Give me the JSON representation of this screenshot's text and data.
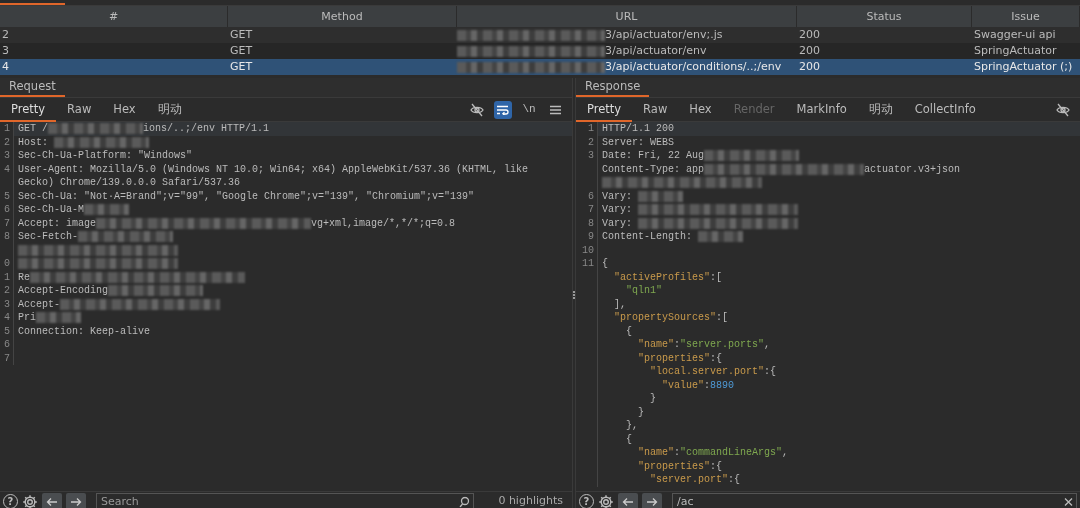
{
  "table": {
    "columns": [
      "#",
      "Method",
      "URL",
      "Status",
      "Issue"
    ],
    "rows": [
      {
        "number": "2",
        "method": "GET",
        "url_prefix_redacted": true,
        "url": "3/api/actuator/env;.js",
        "status": "200",
        "issue": "Swagger-ui api",
        "selected": false
      },
      {
        "number": "3",
        "method": "GET",
        "url_prefix_redacted": true,
        "url": "3/api/actuator/env",
        "status": "200",
        "issue": "SpringActuator",
        "selected": false
      },
      {
        "number": "4",
        "method": "GET",
        "url_prefix_redacted": true,
        "url": "3/api/actuator/conditions/..;/env",
        "status": "200",
        "issue": "SpringActuator (;)",
        "selected": true
      }
    ]
  },
  "request": {
    "title": "Request",
    "tabs": [
      {
        "label": "Pretty",
        "selected": true,
        "disabled": false
      },
      {
        "label": "Raw",
        "selected": false,
        "disabled": false
      },
      {
        "label": "Hex",
        "selected": false,
        "disabled": false
      },
      {
        "label": "明动",
        "selected": false,
        "disabled": false
      }
    ],
    "tools": [
      {
        "kind": "hide",
        "on": false
      },
      {
        "kind": "wrap",
        "on": true
      },
      {
        "kind": "newline",
        "label": "\\n",
        "on": false
      },
      {
        "kind": "menu",
        "on": false
      }
    ],
    "lines": [
      {
        "gutter": "1",
        "highlighted": true,
        "segments": [
          {
            "kind": "plain",
            "text": "GET /"
          },
          {
            "kind": "redacted_medium"
          },
          {
            "kind": "plain",
            "text": "ions/..;/env HTTP/1.1"
          }
        ]
      },
      {
        "gutter": "2",
        "highlighted": false,
        "segments": [
          {
            "kind": "plain",
            "text": "Host: "
          },
          {
            "kind": "redacted_medium"
          }
        ]
      },
      {
        "gutter": "3",
        "highlighted": false,
        "segments": [
          {
            "kind": "plain",
            "text": "Sec-Ch-Ua-Platform: \"Windows\""
          }
        ]
      },
      {
        "gutter": "4",
        "highlighted": false,
        "segments": [
          {
            "kind": "plain",
            "text": "User-Agent: Mozilla/5.0 (Windows NT 10.0; Win64; x64) AppleWebKit/537.36 (KHTML, like"
          }
        ]
      },
      {
        "highlighted": false,
        "segments": [
          {
            "kind": "plain",
            "text": "Gecko) Chrome/139.0.0.0 Safari/537.36"
          }
        ]
      },
      {
        "gutter": "5",
        "highlighted": false,
        "segments": [
          {
            "kind": "plain",
            "text": "Sec-Ch-Ua: \"Not·A=Brand\";v=\"99\", \"Google Chrome\";v=\"139\", \"Chromium\";v=\"139\""
          }
        ]
      },
      {
        "gutter": "6",
        "highlighted": false,
        "segments": [
          {
            "kind": "plain",
            "text": "Sec-Ch-Ua-M"
          },
          {
            "kind": "redacted_short"
          }
        ]
      },
      {
        "gutter": "7",
        "highlighted": false,
        "segments": [
          {
            "kind": "plain",
            "text": "Accept: image"
          },
          {
            "kind": "redacted_wide"
          },
          {
            "kind": "plain",
            "text": "vg+xml,image/*,*/*;q=0.8"
          }
        ]
      },
      {
        "gutter": "8",
        "highlighted": false,
        "segments": [
          {
            "kind": "plain",
            "text": "Sec-Fetch-"
          },
          {
            "kind": "redacted_medium"
          }
        ]
      },
      {
        "highlighted": false,
        "segments": [
          {
            "kind": "redacted_long"
          }
        ]
      },
      {
        "gutter": "0",
        "highlighted": false,
        "segments": [
          {
            "kind": "redacted_long"
          }
        ]
      },
      {
        "gutter": "1",
        "highlighted": false,
        "segments": [
          {
            "kind": "plain",
            "text": "Re"
          },
          {
            "kind": "redacted_wide"
          }
        ]
      },
      {
        "gutter": "2",
        "highlighted": false,
        "segments": [
          {
            "kind": "plain",
            "text": "Accept-Encoding"
          },
          {
            "kind": "redacted_medium"
          }
        ]
      },
      {
        "gutter": "3",
        "highlighted": false,
        "segments": [
          {
            "kind": "plain",
            "text": "Accept-"
          },
          {
            "kind": "redacted_long"
          }
        ]
      },
      {
        "gutter": "4",
        "highlighted": false,
        "segments": [
          {
            "kind": "plain",
            "text": "Pri"
          },
          {
            "kind": "redacted_short"
          }
        ]
      },
      {
        "gutter": "5",
        "highlighted": false,
        "segments": [
          {
            "kind": "plain",
            "text": "Connection: Keep-alive"
          }
        ]
      },
      {
        "gutter": "6",
        "highlighted": false
      },
      {
        "gutter": "7",
        "highlighted": false
      }
    ],
    "footer": {
      "help": "?",
      "search": {
        "placeholder": "Search"
      },
      "highlights": "0 highlights"
    }
  },
  "response": {
    "title": "Response",
    "tabs": [
      {
        "label": "Pretty",
        "selected": true,
        "disabled": false
      },
      {
        "label": "Raw",
        "selected": false,
        "disabled": false
      },
      {
        "label": "Hex",
        "selected": false,
        "disabled": false
      },
      {
        "label": "Render",
        "selected": false,
        "disabled": true
      },
      {
        "label": "MarkInfo",
        "selected": false,
        "disabled": false
      },
      {
        "label": "明动",
        "selected": false,
        "disabled": false
      },
      {
        "label": "CollectInfo",
        "selected": false,
        "disabled": false
      }
    ],
    "tools": [
      {
        "kind": "hide",
        "on": false
      }
    ],
    "lines": [
      {
        "gutter": "1",
        "highlighted": true,
        "segments": [
          {
            "kind": "plain",
            "text": "HTTP/1.1 200"
          }
        ]
      },
      {
        "gutter": "2",
        "highlighted": false,
        "segments": [
          {
            "kind": "plain",
            "text": "Server: WEBS"
          }
        ]
      },
      {
        "gutter": "3",
        "highlighted": false,
        "segments": [
          {
            "kind": "plain",
            "text": "Date: Fri, 22 Aug"
          },
          {
            "kind": "redacted_medium"
          }
        ]
      },
      {
        "highlighted": false,
        "segments": [
          {
            "kind": "plain",
            "text": "Content-Type: app"
          },
          {
            "kind": "redacted_long"
          },
          {
            "kind": "plain",
            "text": "actuator.v3+json"
          }
        ]
      },
      {
        "highlighted": false,
        "segments": [
          {
            "kind": "redacted_long"
          }
        ]
      },
      {
        "gutter": "6",
        "highlighted": false,
        "segments": [
          {
            "kind": "plain",
            "text": "Vary: "
          },
          {
            "kind": "redacted_short"
          }
        ]
      },
      {
        "gutter": "7",
        "highlighted": false,
        "segments": [
          {
            "kind": "plain",
            "text": "Vary: "
          },
          {
            "kind": "redacted_long"
          }
        ]
      },
      {
        "gutter": "8",
        "highlighted": false,
        "segments": [
          {
            "kind": "plain",
            "text": "Vary: "
          },
          {
            "kind": "redacted_long"
          }
        ]
      },
      {
        "gutter": "9",
        "highlighted": false,
        "segments": [
          {
            "kind": "plain",
            "text": "Content-Length: "
          },
          {
            "kind": "redacted_short"
          }
        ]
      },
      {
        "gutter": "10",
        "highlighted": false
      },
      {
        "gutter": "11",
        "highlighted": false,
        "segments": [
          {
            "kind": "plain",
            "text": "{"
          }
        ]
      },
      {
        "highlighted": false,
        "segments": [
          {
            "kind": "key",
            "text": "  \"activeProfiles\""
          },
          {
            "kind": "plain",
            "text": ":["
          }
        ]
      },
      {
        "highlighted": false,
        "segments": [
          {
            "kind": "string",
            "text": "    \"qln1\""
          }
        ]
      },
      {
        "highlighted": false,
        "segments": [
          {
            "kind": "plain",
            "text": "  ],"
          }
        ]
      },
      {
        "highlighted": false,
        "segments": [
          {
            "kind": "key",
            "text": "  \"propertySources\""
          },
          {
            "kind": "plain",
            "text": ":["
          }
        ]
      },
      {
        "highlighted": false,
        "segments": [
          {
            "kind": "plain",
            "text": "    {"
          }
        ]
      },
      {
        "highlighted": false,
        "segments": [
          {
            "kind": "key",
            "text": "      \"name\""
          },
          {
            "kind": "plain",
            "text": ":"
          },
          {
            "kind": "string",
            "text": "\"server.ports\""
          },
          {
            "kind": "plain",
            "text": ","
          }
        ]
      },
      {
        "highlighted": false,
        "segments": [
          {
            "kind": "key",
            "text": "      \"properties\""
          },
          {
            "kind": "plain",
            "text": ":{"
          }
        ]
      },
      {
        "highlighted": false,
        "segments": [
          {
            "kind": "key",
            "text": "        \"local.server.port\""
          },
          {
            "kind": "plain",
            "text": ":{"
          }
        ]
      },
      {
        "highlighted": false,
        "segments": [
          {
            "kind": "key",
            "text": "          \"value\""
          },
          {
            "kind": "plain",
            "text": ":"
          },
          {
            "kind": "number",
            "text": "8890"
          }
        ]
      },
      {
        "highlighted": false,
        "segments": [
          {
            "kind": "plain",
            "text": "        }"
          }
        ]
      },
      {
        "highlighted": false,
        "segments": [
          {
            "kind": "plain",
            "text": "      }"
          }
        ]
      },
      {
        "highlighted": false,
        "segments": [
          {
            "kind": "plain",
            "text": "    },"
          }
        ]
      },
      {
        "highlighted": false,
        "segments": [
          {
            "kind": "plain",
            "text": "    {"
          }
        ]
      },
      {
        "highlighted": false,
        "segments": [
          {
            "kind": "key",
            "text": "      \"name\""
          },
          {
            "kind": "plain",
            "text": ":"
          },
          {
            "kind": "string",
            "text": "\"commandLineArgs\""
          },
          {
            "kind": "plain",
            "text": ","
          }
        ]
      },
      {
        "highlighted": false,
        "segments": [
          {
            "kind": "key",
            "text": "      \"properties\""
          },
          {
            "kind": "plain",
            "text": ":{"
          }
        ]
      },
      {
        "highlighted": false,
        "segments": [
          {
            "kind": "key",
            "text": "        \"server.port\""
          },
          {
            "kind": "plain",
            "text": ":{"
          }
        ]
      }
    ],
    "footer": {
      "help": "?",
      "search": {
        "value": "/ac"
      }
    }
  }
}
